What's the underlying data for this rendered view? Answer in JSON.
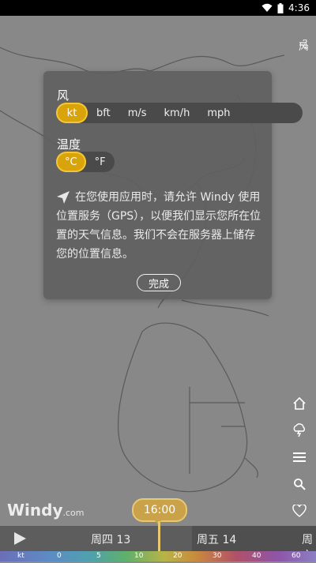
{
  "status": {
    "time": "4:36"
  },
  "map": {
    "layer_label": "风"
  },
  "dialog": {
    "wind_title": "风",
    "wind_units": [
      "kt",
      "bft",
      "m/s",
      "km/h",
      "mph"
    ],
    "wind_selected": "kt",
    "temp_title": "温度",
    "temp_units": [
      "°C",
      "°F"
    ],
    "temp_selected": "°C",
    "permission_text": "在您使用应用时，请允许 Windy 使用位置服务（GPS），以便我们显示您所在位置的天气信息。我们不会在服务器上储存您的位置信息。",
    "done_label": "完成"
  },
  "side_tools": [
    "home-icon",
    "storm-icon",
    "menu-icon",
    "search-icon",
    "heart-icon"
  ],
  "logo": {
    "main": "Windy",
    "suffix": ".com"
  },
  "timeline": {
    "current_time": "16:00",
    "days": [
      "周四 13",
      "周五 14",
      "周六"
    ]
  },
  "scale": {
    "unit": "kt",
    "ticks": [
      "0",
      "5",
      "10",
      "20",
      "30",
      "40",
      "60"
    ]
  },
  "colors": {
    "accent": "#d9a30a",
    "dialog_bg": "#606060",
    "map_bg": "#888888",
    "timeline_bg": "#5d5d5d"
  }
}
